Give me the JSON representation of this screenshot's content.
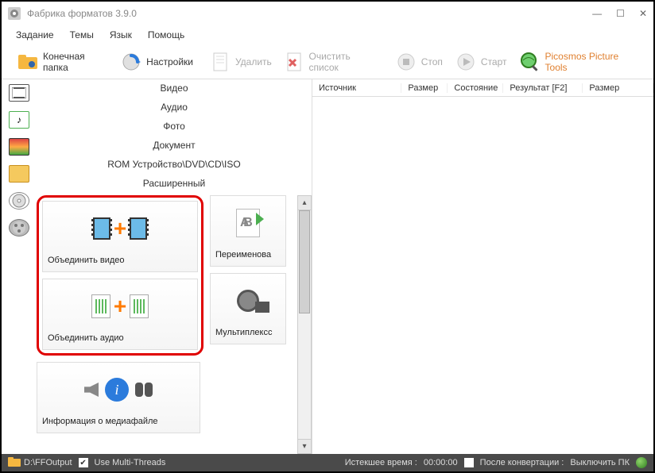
{
  "window": {
    "title": "Фабрика форматов 3.9.0"
  },
  "menu": {
    "task": "Задание",
    "themes": "Темы",
    "language": "Язык",
    "help": "Помощь"
  },
  "toolbar": {
    "output_folder": "Конечная папка",
    "settings": "Настройки",
    "delete": "Удалить",
    "clear_list": "Очистить список",
    "stop": "Стоп",
    "start": "Старт",
    "picosmos": "Picosmos Picture Tools"
  },
  "categories": {
    "video": "Видео",
    "audio": "Аудио",
    "photo": "Фото",
    "document": "Документ",
    "rom": "ROM Устройство\\DVD\\CD\\ISO",
    "advanced": "Расширенный"
  },
  "tiles": {
    "merge_video": "Объединить видео",
    "merge_audio": "Объединить аудио",
    "rename": "Переименова",
    "mux": "Мультиплексс",
    "media_info": "Информация о медиафайле"
  },
  "columns": {
    "source": "Источник",
    "size": "Размер",
    "state": "Состояние",
    "result": "Результат [F2]",
    "size2": "Размер"
  },
  "status": {
    "path": "D:\\FFOutput",
    "multithreads": "Use Multi-Threads",
    "elapsed_label": "Истекшее время :",
    "elapsed_value": "00:00:00",
    "after_label": "После конвертации :",
    "after_value": "Выключить ПК"
  }
}
